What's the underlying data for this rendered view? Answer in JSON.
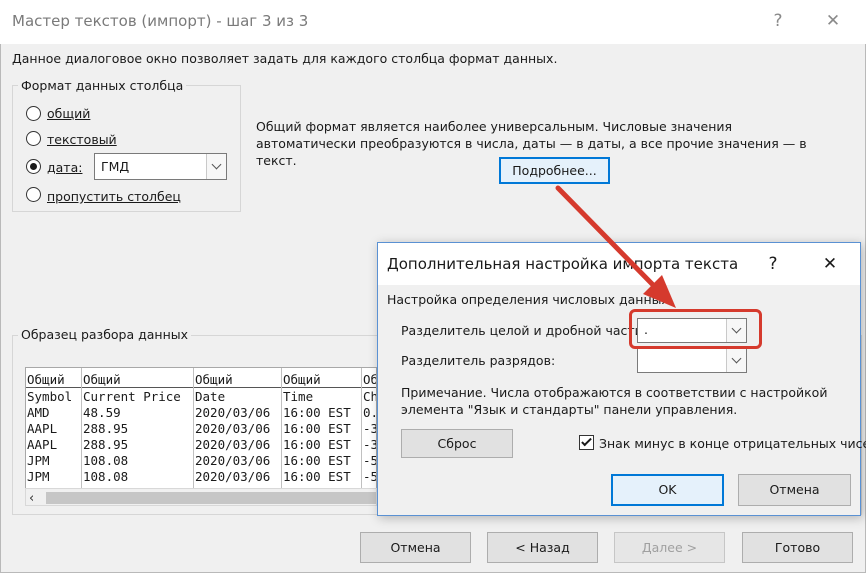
{
  "window": {
    "title": "Мастер текстов (импорт) - шаг 3 из 3",
    "help_glyph": "?",
    "close_glyph": "✕"
  },
  "description": "Данное диалоговое окно позволяет задать для каждого столбца формат данных.",
  "column_format": {
    "group_label": "Формат данных столбца",
    "options": [
      {
        "label": "общий",
        "checked": false
      },
      {
        "label": "текстовый",
        "checked": false
      },
      {
        "label": "дата:",
        "checked": true
      },
      {
        "label": "пропустить столбец",
        "checked": false
      }
    ],
    "date_format_value": "ГМД"
  },
  "info_text": "Общий формат является наиболее универсальным. Числовые значения автоматически преобразуются в числа, даты — в даты, а все прочие значения — в текст.",
  "more_button": "Подробнее...",
  "preview": {
    "group_label": "Образец разбора данных",
    "header_row": [
      "Общий",
      "Общий",
      "Общий",
      "Общий",
      "Об"
    ],
    "rows": [
      [
        "Symbol",
        "Current Price",
        "Date",
        "Time",
        "Ch"
      ],
      [
        "AMD",
        "48.59",
        "2020/03/06",
        "16:00 EST",
        "0."
      ],
      [
        "AAPL",
        "288.95",
        "2020/03/06",
        "16:00 EST",
        "-3"
      ],
      [
        "AAPL",
        "288.95",
        "2020/03/06",
        "16:00 EST",
        "-3"
      ],
      [
        "JPM",
        "108.08",
        "2020/03/06",
        "16:00 EST",
        "-5"
      ],
      [
        "JPM",
        "108.08",
        "2020/03/06",
        "16:00 EST",
        "-5"
      ]
    ],
    "scroll_left_glyph": "‹"
  },
  "footer": {
    "cancel": "Отмена",
    "back": "< Назад",
    "next": "Далее >",
    "finish": "Готово"
  },
  "advanced": {
    "title": "Дополнительная настройка импорта текста",
    "help_glyph": "?",
    "close_glyph": "✕",
    "section_label": "Настройка определения числовых данных",
    "decimal_label": "Разделитель целой и дробной части:",
    "decimal_value": ".",
    "thousands_label": "Разделитель разрядов:",
    "thousands_value": "",
    "note": "Примечание. Числа отображаются в соответствии с настройкой элемента \"Язык и стандарты\" панели управления.",
    "reset_button": "Сброс",
    "trailing_minus_label": "Знак минус в конце отрицательных чисел",
    "trailing_minus_checked": true,
    "ok": "OK",
    "cancel": "Отмена"
  },
  "annotation_color": "#d53a2d",
  "accent_color": "#0078d7"
}
